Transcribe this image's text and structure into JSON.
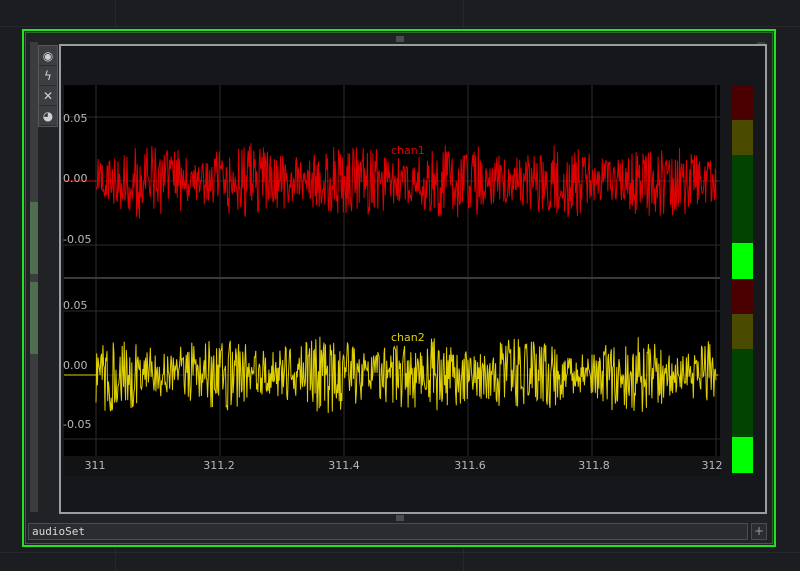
{
  "viewer": {
    "status_name": "audioSet",
    "plus_label": "+"
  },
  "toolbar": {
    "tools": [
      {
        "name": "viewer-active-icon",
        "glyph": "◉"
      },
      {
        "name": "lightning-icon",
        "glyph": "ϟ"
      },
      {
        "name": "close-icon",
        "glyph": "✕"
      },
      {
        "name": "lock-icon",
        "glyph": "◕"
      }
    ]
  },
  "colors": {
    "chan1": "#e00000",
    "chan2": "#e0d000",
    "frame": "#22e022",
    "meter_green": "#00ff00"
  },
  "chart_data": {
    "type": "line",
    "x_ticks": [
      "311",
      "311.2",
      "311.4",
      "311.6",
      "311.8",
      "312"
    ],
    "xlim": [
      311,
      312
    ],
    "channels": [
      {
        "name": "chan1",
        "y_ticks": [
          "0.05",
          "0.00",
          "-0.05"
        ],
        "ylim": [
          -0.075,
          0.075
        ],
        "amplitude": 0.03,
        "meter_level": 0.28
      },
      {
        "name": "chan2",
        "y_ticks": [
          "0.05",
          "0.00",
          "-0.05"
        ],
        "ylim": [
          -0.075,
          0.075
        ],
        "amplitude": 0.03,
        "meter_level": 0.28
      }
    ]
  }
}
